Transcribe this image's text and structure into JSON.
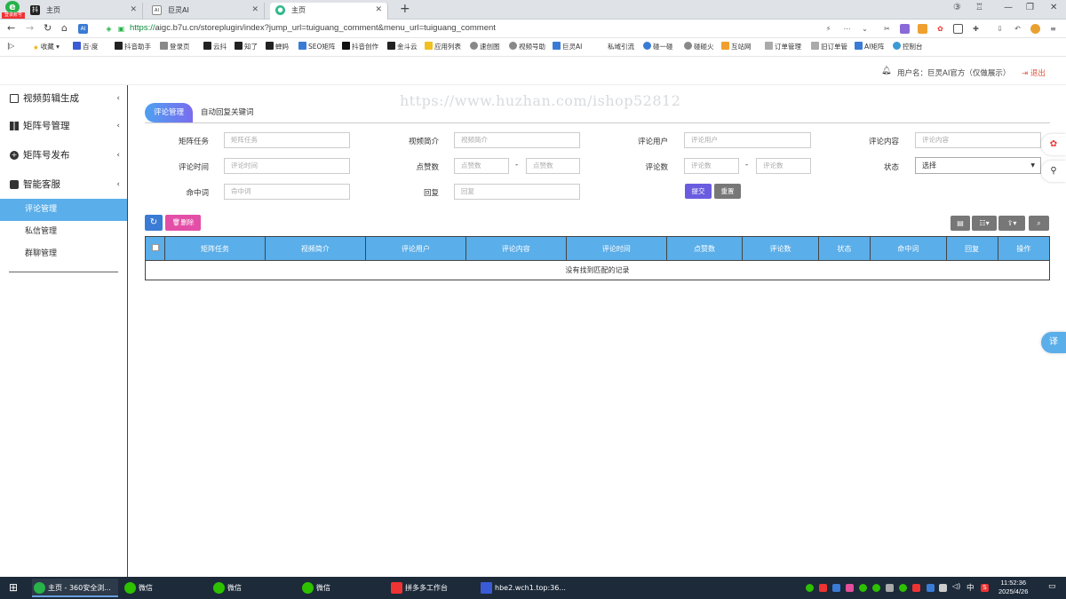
{
  "browser": {
    "logo_tag": "登录账号",
    "tabs": [
      {
        "label": "主页",
        "icon": "抖"
      },
      {
        "label": "巨灵AI",
        "icon": "AI"
      },
      {
        "label": "主页",
        "icon": "●"
      }
    ],
    "url_scheme": "https://",
    "url_domain": "aigc.b7u.cn",
    "url_path": "/storeplugin/index?jump_url=tuiguang_comment&menu_url=tuiguang_comment",
    "bookmarks": [
      "收藏",
      "百·度",
      "抖音助手",
      "登录页",
      "云抖",
      "知了",
      "蝉妈",
      "SEO矩阵",
      "抖音创作",
      "金斗云",
      "应用列表",
      "速创图",
      "视频号助",
      "巨灵AI",
      "私域引流",
      "碰一碰",
      "碰碰火",
      "互站网",
      "订单管理",
      "旧订单管",
      "AI矩阵",
      "控制台"
    ]
  },
  "header": {
    "user_label": "用户名：巨灵AI官方（仅做展示）",
    "logout_label": "退出"
  },
  "sidebar": {
    "items": [
      {
        "label": "视频剪辑生成",
        "icon": "film-icon"
      },
      {
        "label": "矩阵号管理",
        "icon": "grid-icon"
      },
      {
        "label": "矩阵号发布",
        "icon": "plus-circle-icon"
      },
      {
        "label": "智能客服",
        "icon": "robot-icon"
      }
    ],
    "sub_items": [
      "评论管理",
      "私信管理",
      "群聊管理"
    ]
  },
  "watermark": "https://www.huzhan.com/ishop52812",
  "content_tabs": [
    "评论管理",
    "自动回复关键词"
  ],
  "form": {
    "fields": [
      {
        "label": "矩阵任务",
        "placeholder": "矩阵任务"
      },
      {
        "label": "视频简介",
        "placeholder": "视频简介"
      },
      {
        "label": "评论用户",
        "placeholder": "评论用户"
      },
      {
        "label": "评论内容",
        "placeholder": "评论内容"
      },
      {
        "label": "评论时间",
        "placeholder": "评论时间"
      },
      {
        "label": "点赞数",
        "placeholder_min": "点赞数",
        "placeholder_max": "点赞数"
      },
      {
        "label": "评论数",
        "placeholder_min": "评论数",
        "placeholder_max": "评论数"
      },
      {
        "label": "状态",
        "value": "选择"
      },
      {
        "label": "命中词",
        "placeholder": "命中词"
      },
      {
        "label": "回复",
        "placeholder": "回复"
      }
    ],
    "dash": "-",
    "submit_label": "提交",
    "reset_label": "重置"
  },
  "toolbar": {
    "delete_label": "删除",
    "refresh_color": "#3a7bd5",
    "delete_color": "#e34fa7"
  },
  "table": {
    "columns": [
      "矩阵任务",
      "视频简介",
      "评论用户",
      "评论内容",
      "评论时间",
      "点赞数",
      "评论数",
      "状态",
      "命中词",
      "回复",
      "操作"
    ],
    "empty_text": "没有找到匹配的记录"
  },
  "floating": {
    "translate": "译"
  },
  "taskbar": {
    "tasks": [
      "主页 - 360安全浏...",
      "微信",
      "微信",
      "微信",
      "拼多多工作台",
      "hbe2.wch1.top:36..."
    ],
    "time": "11:52:36",
    "date": "2025/4/26",
    "ime": "中"
  },
  "colors": {
    "accent": "#5aaee9",
    "submit": "#6a5ce0",
    "reset": "#777777"
  }
}
